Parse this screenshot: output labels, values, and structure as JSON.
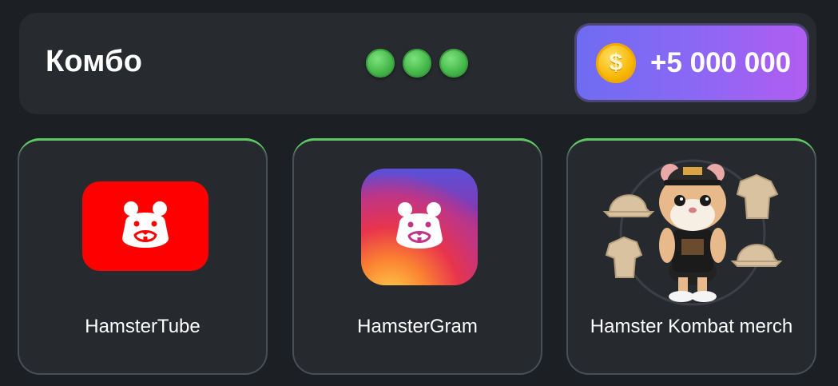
{
  "header": {
    "title": "Комбо",
    "dots": [
      "found",
      "found",
      "found"
    ],
    "reward": {
      "icon": "coin-icon",
      "coin_symbol": "$",
      "amount": "+5 000 000"
    }
  },
  "cards": [
    {
      "label": "HamsterTube",
      "icon": "hamstertube-logo"
    },
    {
      "label": "HamsterGram",
      "icon": "hamstergram-logo"
    },
    {
      "label": "Hamster Kombat merch",
      "icon": "hamster-merch-image"
    }
  ],
  "colors": {
    "accent": "#57c55c",
    "youtube_red": "#fe0000",
    "reward_gradient": [
      "#6e6cf2",
      "#b15df2"
    ]
  }
}
